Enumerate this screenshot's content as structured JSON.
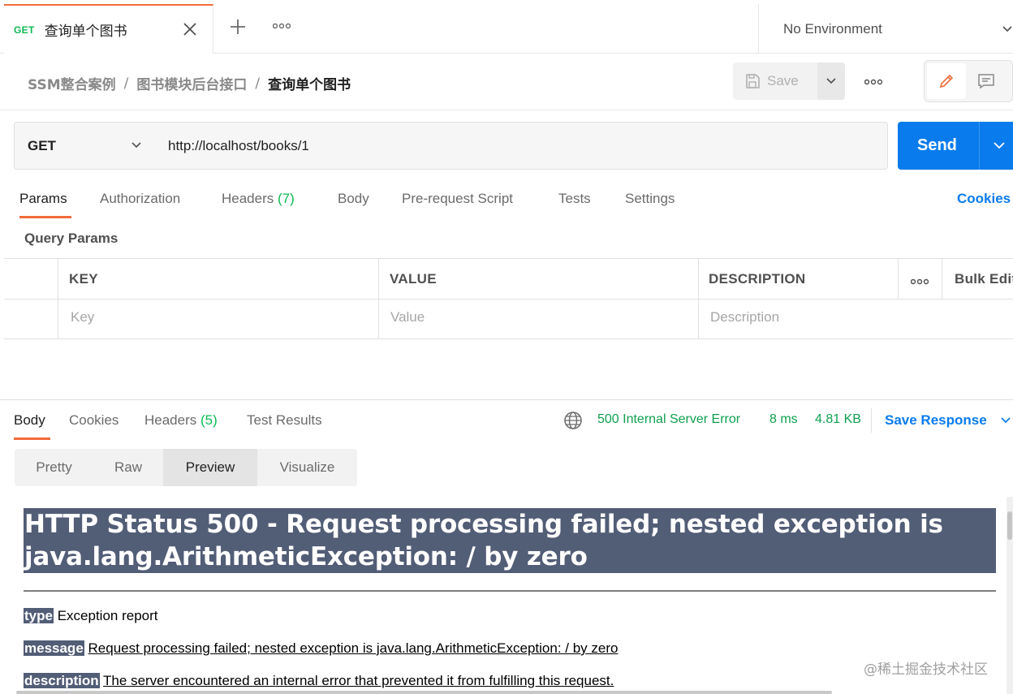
{
  "tab": {
    "method": "GET",
    "title": "查询单个图书"
  },
  "environment": {
    "label": "No Environment"
  },
  "breadcrumb": {
    "items": [
      "SSM整合案例",
      "图书模块后台接口"
    ],
    "separator": "/",
    "current": "查询单个图书"
  },
  "toolbar": {
    "save_label": "Save"
  },
  "request": {
    "method": "GET",
    "url": "http://localhost/books/1",
    "send_label": "Send"
  },
  "request_tabs": {
    "params": "Params",
    "authorization": "Authorization",
    "headers": "Headers",
    "headers_count": "(7)",
    "body": "Body",
    "prerequest": "Pre-request Script",
    "tests": "Tests",
    "settings": "Settings",
    "cookies": "Cookies"
  },
  "query_params": {
    "title": "Query Params",
    "headers": {
      "key": "KEY",
      "value": "VALUE",
      "description": "DESCRIPTION",
      "bulk_edit": "Bulk Edit"
    },
    "placeholders": {
      "key": "Key",
      "value": "Value",
      "description": "Description"
    }
  },
  "response_tabs": {
    "body": "Body",
    "cookies": "Cookies",
    "headers": "Headers",
    "headers_count": "(5)",
    "test_results": "Test Results"
  },
  "response_status": {
    "status": "500 Internal Server Error",
    "time": "8 ms",
    "size": "4.81 KB",
    "save_response": "Save Response"
  },
  "view_modes": {
    "pretty": "Pretty",
    "raw": "Raw",
    "preview": "Preview",
    "visualize": "Visualize",
    "active": "Preview"
  },
  "preview": {
    "title_line1": "HTTP Status 500 - Request processing failed; nested exception is",
    "title_line2": "java.lang.ArithmeticException: / by zero",
    "type_key": "type",
    "type_value": "Exception report",
    "message_key": "message",
    "message_value": "Request processing failed; nested exception is java.lang.ArithmeticException: / by zero",
    "description_key": "description",
    "description_value": "The server encountered an internal error that prevented it from fulfilling this request."
  },
  "watermark": "@稀土掘金技术社区",
  "colors": {
    "accent_orange": "#f26b3a",
    "send_blue": "#097bed",
    "success_green": "#0cbb52",
    "tomcat_header": "#525d76"
  }
}
